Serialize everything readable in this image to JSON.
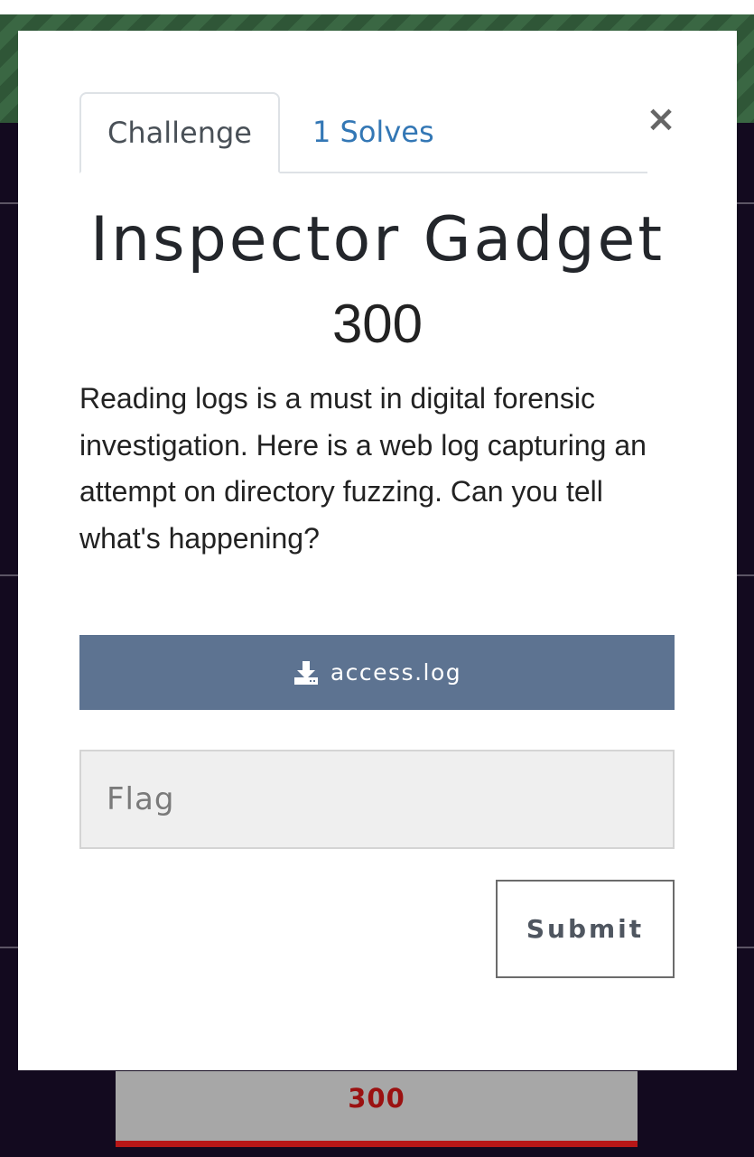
{
  "modal": {
    "tabs": [
      {
        "label": "Challenge",
        "active": true
      },
      {
        "label": "1 Solves",
        "active": false
      }
    ],
    "close_label": "×",
    "title": "Inspector Gadget",
    "points": "300",
    "description": "Reading logs is a must in digital forensic investigation. Here is a web log capturing an attempt on directory fuzzing. Can you tell what's happening?",
    "download": {
      "label": "access.log",
      "icon": "download-icon"
    },
    "flag_input": {
      "placeholder": "Flag",
      "value": ""
    },
    "submit_label": "Submit"
  },
  "background": {
    "card_points": "300"
  },
  "colors": {
    "tab_link": "#3377b5",
    "download_button": "#5d7391",
    "card_points": "#9b1111",
    "background_band": "#2f5637",
    "page_background": "#130a1f"
  }
}
